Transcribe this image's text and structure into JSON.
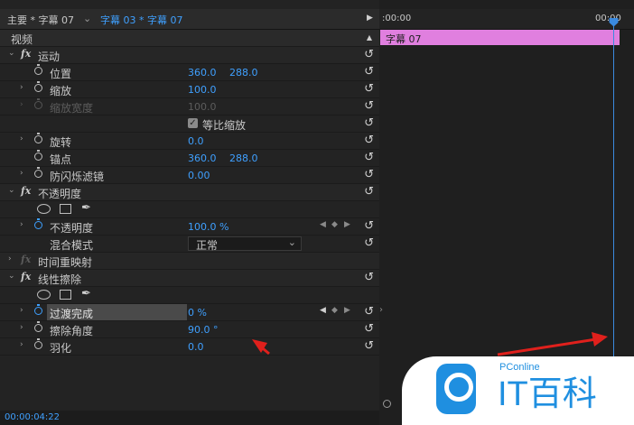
{
  "tabs": {
    "source": "主要 * 字幕 07",
    "sequence": "字幕 03 * 字幕 07",
    "play_glyph": "▶"
  },
  "panel": {
    "section_label": "视频",
    "collapse_glyph": "▲"
  },
  "motion": {
    "label": "运动",
    "position_label": "位置",
    "position_x": "360.0",
    "position_y": "288.0",
    "scale_label": "缩放",
    "scale_value": "100.0",
    "scale_width_label": "缩放宽度",
    "scale_width_value": "100.0",
    "uniform_scale_label": "等比缩放",
    "rotation_label": "旋转",
    "rotation_value": "0.0",
    "anchor_label": "锚点",
    "anchor_x": "360.0",
    "anchor_y": "288.0",
    "antiflicker_label": "防闪烁滤镜",
    "antiflicker_value": "0.00"
  },
  "opacity": {
    "label": "不透明度",
    "opacity_label": "不透明度",
    "opacity_value": "100.0 %",
    "blend_label": "混合模式",
    "blend_value": "正常"
  },
  "time_remap": {
    "label": "时间重映射"
  },
  "linear_wipe": {
    "label": "线性擦除",
    "completion_label": "过渡完成",
    "completion_value": "0 %",
    "angle_label": "擦除角度",
    "angle_value": "90.0 °",
    "feather_label": "羽化",
    "feather_value": "0.0"
  },
  "timeline": {
    "start_time": ":00:00",
    "end_time": "00:00",
    "clip_label": "字幕 07"
  },
  "status": {
    "timecode": "00:00:04:22"
  },
  "logo": {
    "brand": "PConline",
    "name": "IT百科"
  },
  "colors": {
    "accent": "#3fa0ff",
    "clip": "#e07fdf",
    "annotation": "#e0201c"
  },
  "icons": {
    "reset": "↺",
    "fx": "fx",
    "check": "✓",
    "pen": "✒",
    "chevron_right": "›",
    "chevron_down": "⌄",
    "kf_prev": "◀",
    "kf_add": "◆",
    "kf_next": "▶"
  }
}
